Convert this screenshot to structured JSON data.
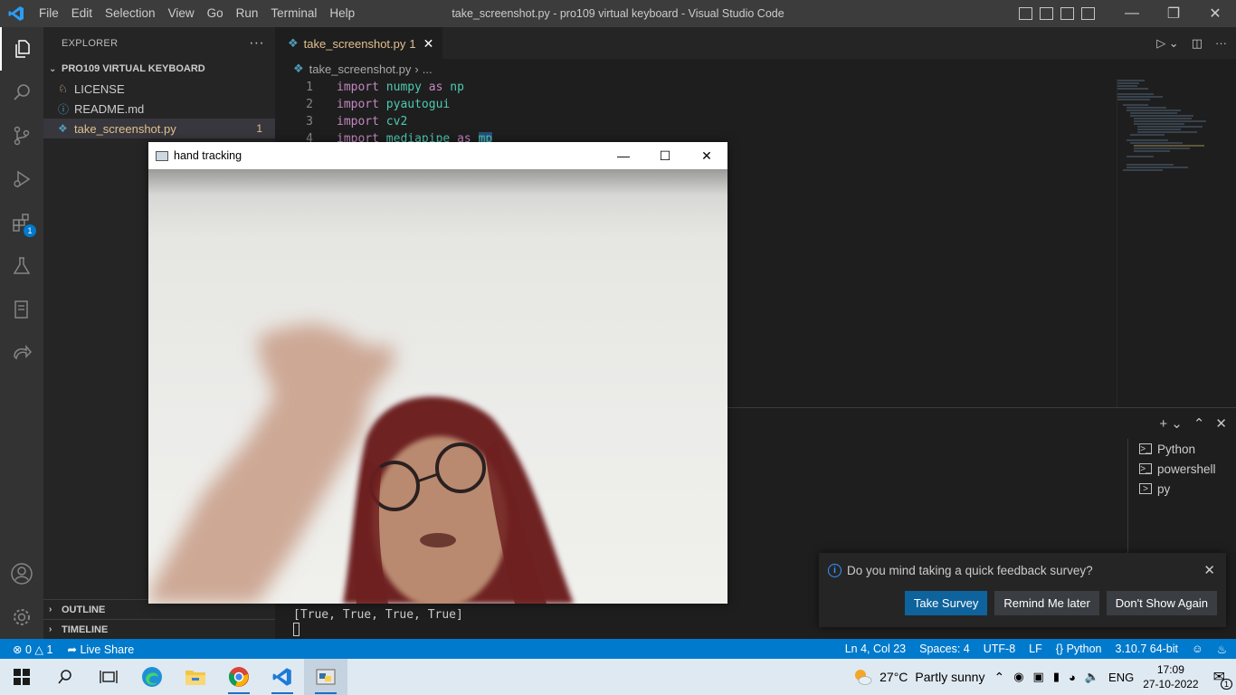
{
  "titlebar": {
    "menu": [
      "File",
      "Edit",
      "Selection",
      "View",
      "Go",
      "Run",
      "Terminal",
      "Help"
    ],
    "window_title": "take_screenshot.py - pro109 virtual keyboard - Visual Studio Code"
  },
  "sidebar": {
    "header": "EXPLORER",
    "folder": "PRO109 VIRTUAL KEYBOARD",
    "files": [
      {
        "name": "LICENSE",
        "icon": "license-icon"
      },
      {
        "name": "README.md",
        "icon": "info-icon"
      },
      {
        "name": "take_screenshot.py",
        "icon": "python-icon",
        "problems": "1"
      }
    ],
    "outline": "OUTLINE",
    "timeline": "TIMELINE",
    "extensions_badge": "1"
  },
  "editor": {
    "tab_label": "take_screenshot.py",
    "tab_problems": "1",
    "breadcrumb_file": "take_screenshot.py",
    "breadcrumb_more": "...",
    "lines": [
      {
        "num": "1",
        "kw": "import",
        "mod": "numpy",
        "as": "as",
        "alias": "np"
      },
      {
        "num": "2",
        "kw": "import",
        "mod": "pyautogui"
      },
      {
        "num": "3",
        "kw": "import",
        "mod": "cv2"
      },
      {
        "num": "4",
        "kw": "import",
        "mod": "mediapipe",
        "as": "as",
        "alias": "mp"
      }
    ]
  },
  "terminal": {
    "list": [
      "Python",
      "powershell",
      "py"
    ],
    "output": "[True, True, True, True]"
  },
  "notification": {
    "message": "Do you mind taking a quick feedback survey?",
    "buttons": [
      "Take Survey",
      "Remind Me later",
      "Don't Show Again"
    ]
  },
  "statusbar": {
    "errors": "0",
    "warnings": "1",
    "live_share": "Live Share",
    "position": "Ln 4, Col 23",
    "spaces": "Spaces: 4",
    "encoding": "UTF-8",
    "eol": "LF",
    "language": "Python",
    "interpreter": "3.10.7 64-bit"
  },
  "camera_window": {
    "title": "hand tracking"
  },
  "taskbar": {
    "weather_temp": "27°C",
    "weather_desc": "Partly sunny",
    "lang": "ENG",
    "time": "17:09",
    "date": "27-10-2022",
    "notif_count": "1"
  },
  "colors": {
    "accent": "#007acc",
    "modified": "#e2c08d",
    "keyword": "#c586c0",
    "module": "#4ec9b0"
  }
}
